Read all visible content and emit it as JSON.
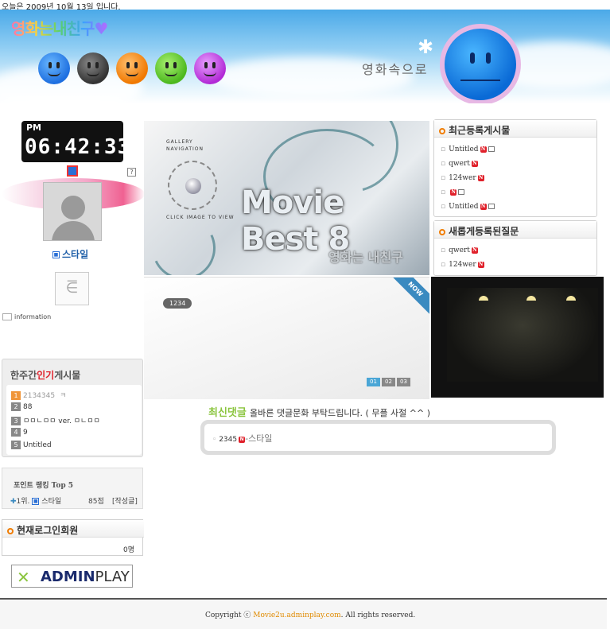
{
  "top_date": "오늘은 2009년 10월 13일 입니다.",
  "header": {
    "logo": "영화는내친구♥",
    "slogan": "영화속으로",
    "faces": [
      {
        "name": "blue-face-icon",
        "color": "#1e6fe0"
      },
      {
        "name": "black-face-icon",
        "color": "#333333"
      },
      {
        "name": "orange-face-icon",
        "color": "#f07800"
      },
      {
        "name": "green-face-icon",
        "color": "#4cb81e"
      },
      {
        "name": "purple-face-icon",
        "color": "#b22ad6"
      }
    ]
  },
  "clock": {
    "ampm": "PM",
    "time": "06:42:33"
  },
  "profile": {
    "nickname": "스타일",
    "info_label": "information"
  },
  "weekly": {
    "title_prefix": "한주간",
    "title_highlight": "인기",
    "title_suffix": "게시물",
    "items": [
      {
        "rank": "1",
        "text": "2134345"
      },
      {
        "rank": "2",
        "text": "88"
      },
      {
        "rank": "3",
        "text": "ㅁㅁㄴㅁㅁ ver. ㅁㄴㅁㅁ"
      },
      {
        "rank": "4",
        "text": "9"
      },
      {
        "rank": "5",
        "text": "Untitled"
      }
    ]
  },
  "points": {
    "title": "포인트 랭킹 Top 5",
    "row_rank": "1위.",
    "row_user": "스타일",
    "row_points": "85점",
    "row_action": "[작성글]"
  },
  "online": {
    "title": "현재로그인회원",
    "count": "0명"
  },
  "adminplay": {
    "brand_bold": "ADMIN",
    "brand_light": "PLAY"
  },
  "banner": {
    "gallery_line1": "GALLERY",
    "gallery_line2": "NAVIGATION",
    "click_text": "CLICK IMAGE TO VIEW",
    "headline": "Movie Best 8",
    "signature": "영화는 내친구"
  },
  "slide": {
    "counter": "1234",
    "ribbon": "NOW",
    "pages": [
      "01",
      "02",
      "03"
    ]
  },
  "comments": {
    "title": "최신댓글",
    "subtitle": "올바른 댓글문화 부탁드립니다. ( 무플 사절 ^^ )",
    "items": [
      {
        "text": "2345",
        "author": "-스타일"
      }
    ]
  },
  "recent": {
    "title": "최근등록게시물",
    "items": [
      "Untitled",
      "qwert",
      "124wer",
      "",
      "Untitled"
    ]
  },
  "qna": {
    "title": "새롭게등록된질문",
    "items": [
      "qwert",
      "124wer"
    ]
  },
  "footer": {
    "prefix": "Copyright ⓒ",
    "site": "Movie2u.adminplay.com",
    "suffix": ". All rights reserved."
  }
}
